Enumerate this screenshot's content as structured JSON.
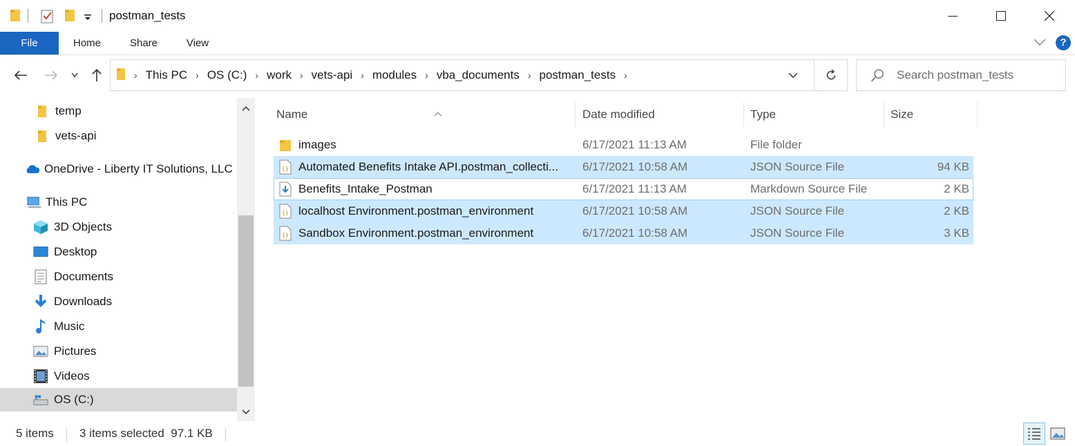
{
  "window": {
    "title": "postman_tests",
    "minimize_glyph": "—",
    "maximize_glyph": "☐",
    "close_glyph": "✕"
  },
  "ribbon": {
    "tabs": [
      "File",
      "Home",
      "Share",
      "View"
    ],
    "help_label": "?"
  },
  "address_bar": {
    "crumbs": [
      "This PC",
      "OS (C:)",
      "work",
      "vets-api",
      "modules",
      "vba_documents",
      "postman_tests"
    ]
  },
  "search": {
    "placeholder": "Search postman_tests"
  },
  "nav_pane": {
    "items": [
      {
        "label": "temp",
        "icon": "folder-icon"
      },
      {
        "label": "vets-api",
        "icon": "folder-icon"
      },
      {
        "label": "OneDrive - Liberty IT Solutions, LLC",
        "icon": "onedrive-icon"
      },
      {
        "label": "This PC",
        "icon": "computer-icon"
      },
      {
        "label": "3D Objects",
        "icon": "3d-objects-icon"
      },
      {
        "label": "Desktop",
        "icon": "desktop-icon"
      },
      {
        "label": "Documents",
        "icon": "documents-icon"
      },
      {
        "label": "Downloads",
        "icon": "downloads-icon"
      },
      {
        "label": "Music",
        "icon": "music-icon"
      },
      {
        "label": "Pictures",
        "icon": "pictures-icon"
      },
      {
        "label": "Videos",
        "icon": "videos-icon"
      },
      {
        "label": "OS (C:)",
        "icon": "drive-icon"
      }
    ]
  },
  "file_list": {
    "columns": [
      "Name",
      "Date modified",
      "Type",
      "Size"
    ],
    "rows": [
      {
        "name": "images",
        "date": "6/17/2021 11:13 AM",
        "type": "File folder",
        "size": "",
        "icon": "folder-icon",
        "state": "normal"
      },
      {
        "name": "Automated Benefits Intake API.postman_collecti...",
        "date": "6/17/2021 10:58 AM",
        "type": "JSON Source File",
        "size": "94 KB",
        "icon": "json-file-icon",
        "state": "selected"
      },
      {
        "name": "Benefits_Intake_Postman",
        "date": "6/17/2021 11:13 AM",
        "type": "Markdown Source File",
        "size": "2 KB",
        "icon": "markdown-file-icon",
        "state": "focused"
      },
      {
        "name": "localhost Environment.postman_environment",
        "date": "6/17/2021 10:58 AM",
        "type": "JSON Source File",
        "size": "2 KB",
        "icon": "json-file-icon",
        "state": "selected"
      },
      {
        "name": "Sandbox Environment.postman_environment",
        "date": "6/17/2021 10:58 AM",
        "type": "JSON Source File",
        "size": "3 KB",
        "icon": "json-file-icon",
        "state": "selected"
      }
    ]
  },
  "status_bar": {
    "item_count": "5 items",
    "selection": "3 items selected  97.1 KB"
  },
  "colors": {
    "accent": "#1a66c0",
    "selection": "#cce8ff",
    "focus_border": "#99d1ff",
    "folder": "#f4c542"
  }
}
